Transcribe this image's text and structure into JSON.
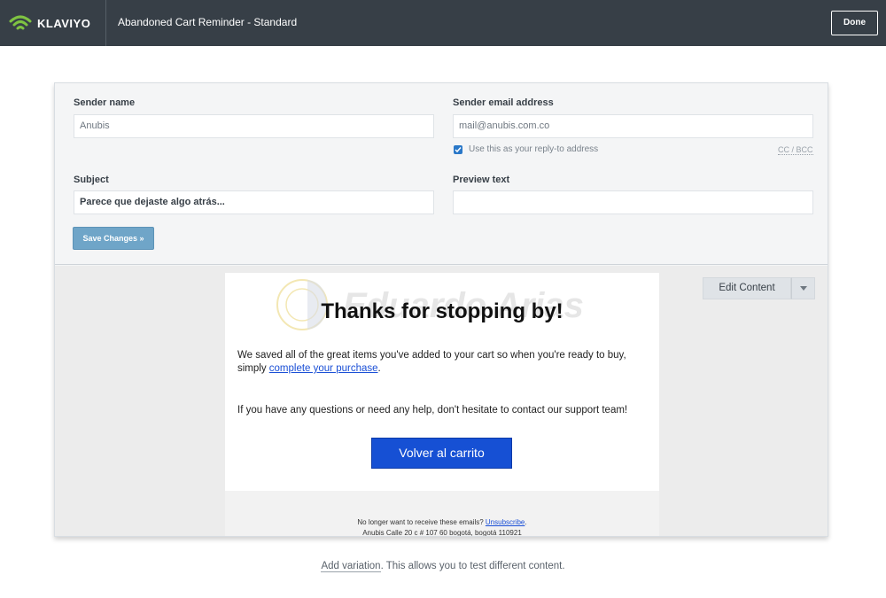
{
  "app": {
    "brand": "KLAVIYO",
    "flow_title": "Abandoned Cart Reminder - Standard",
    "done_label": "Done"
  },
  "form": {
    "sender_name_label": "Sender name",
    "sender_name_value": "Anubis",
    "sender_email_label": "Sender email address",
    "sender_email_value": "mail@anubis.com.co",
    "reply_to_checked": true,
    "reply_to_label": "Use this as your reply-to address",
    "cc_bcc_label": "CC / BCC",
    "subject_label": "Subject",
    "subject_value": "Parece que dejaste algo atrás...",
    "preview_text_label": "Preview text",
    "preview_text_value": "",
    "save_label": "Save Changes »"
  },
  "preview": {
    "edit_content_label": "Edit Content",
    "watermark_text": "Eduardo Arias",
    "email": {
      "heading": "Thanks for stopping by!",
      "body_before_link": "We saved all of the great items you've added to your cart so when you're ready to buy, simply ",
      "body_link": "complete your purchase",
      "body_after_link": ".",
      "body2": "If you have any questions or need any help, don't hesitate to contact our support team!",
      "cta_label": "Volver al carrito",
      "footer_before_link": "No longer want to receive these emails? ",
      "footer_link": "Unsubscribe",
      "footer_after_link": ".",
      "footer_address": "Anubis Calle 20 c # 107 60 bogotá, bogotá 110921"
    }
  },
  "bottom": {
    "variation_link": "Add variation",
    "variation_text": ". This allows you to test different content."
  },
  "colors": {
    "topbar": "#373f47",
    "accent_blue": "#1650d4",
    "save_button": "#6fa5c8",
    "brand_green": "#7fc342"
  }
}
